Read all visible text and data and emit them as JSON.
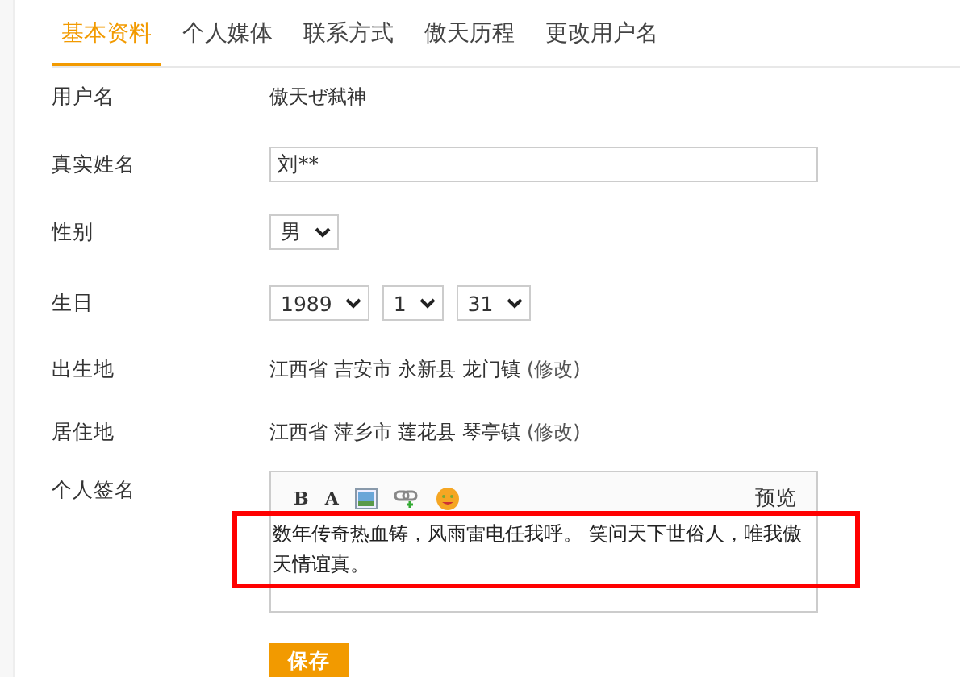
{
  "tabs": [
    {
      "label": "基本资料",
      "selected": true
    },
    {
      "label": "个人媒体",
      "selected": false
    },
    {
      "label": "联系方式",
      "selected": false
    },
    {
      "label": "傲天历程",
      "selected": false
    },
    {
      "label": "更改用户名",
      "selected": false
    }
  ],
  "fields": [
    {
      "kind": "text",
      "label": "用户名",
      "value": "傲天ぜ弑神"
    },
    {
      "kind": "input",
      "label": "真实姓名",
      "value": "刘**"
    },
    {
      "kind": "selects",
      "label": "性别",
      "options": [
        "男"
      ]
    },
    {
      "kind": "selects",
      "label": "生日",
      "options": [
        "1989",
        "1",
        "31"
      ]
    },
    {
      "kind": "address",
      "label": "出生地",
      "value": "江西省 吉安市 永新县 龙门镇",
      "link": "(修改)"
    },
    {
      "kind": "address",
      "label": "居住地",
      "value": "江西省 萍乡市 莲花县 琴亭镇",
      "link": "(修改)"
    },
    {
      "kind": "editor",
      "label": "个人签名",
      "toolbar": [
        "B",
        "A"
      ],
      "preview": "预览",
      "value": "数年传奇热血铸，风雨雷电任我呼。 笑问天下世俗人，唯我傲天情谊真。",
      "highlighted": true
    }
  ],
  "save_button": "保存"
}
